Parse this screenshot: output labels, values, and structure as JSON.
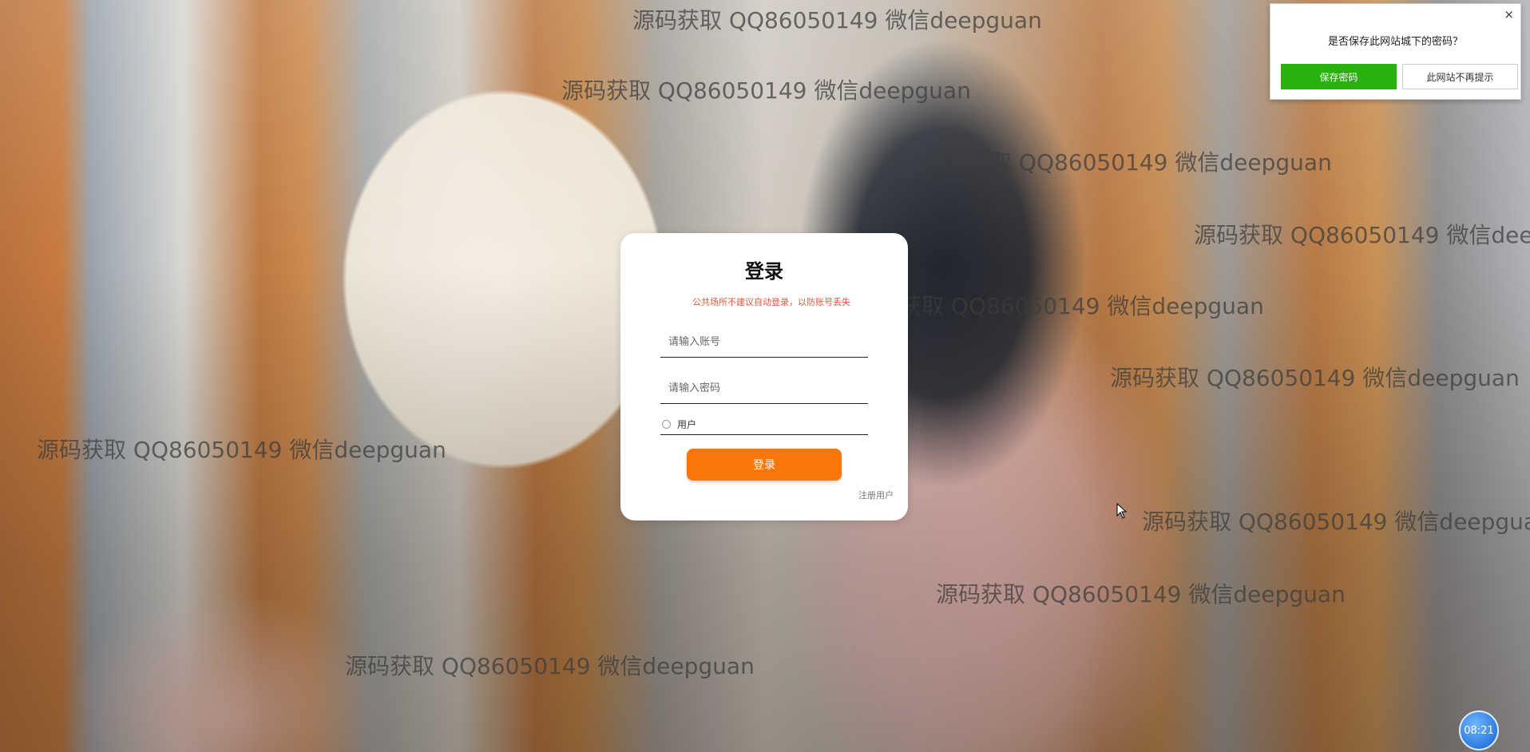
{
  "watermark_text": "源码获取 QQ86050149 微信deepguan",
  "login_card": {
    "title": "登录",
    "notice": "公共场所不建议自动登录，以防账号丢失",
    "username_placeholder": "请输入账号",
    "password_placeholder": "请输入密码",
    "role_option": "用户",
    "login_button": "登录",
    "register_link": "注册用户"
  },
  "password_prompt": {
    "question": "是否保存此网站城下的密码？",
    "save_button": "保存密码",
    "never_button": "此网站不再提示",
    "close_glyph": "×"
  },
  "clock": {
    "time": "08:21"
  },
  "colors": {
    "primary_button": "#fb7608",
    "save_button": "#27b20d",
    "notice_text": "#e2593a"
  }
}
